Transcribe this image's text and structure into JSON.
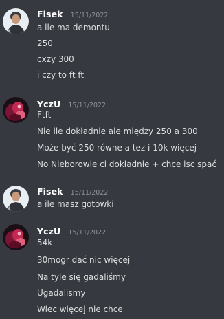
{
  "messages": [
    {
      "username": "Fisek",
      "timestamp": "15/11/2022",
      "lines": [
        "a ile ma demontu",
        "250",
        "cxzy 300",
        "i czy to ft ft"
      ]
    },
    {
      "username": "YczU",
      "timestamp": "15/11/2022",
      "lines": [
        "Ftft",
        "Nie ile dokładnie ale między 250 a 300",
        "Może być 250 równe a tez i 10k więcej",
        "No Nieborowie ci dokładnie + chce isc spać"
      ]
    },
    {
      "username": "Fisek",
      "timestamp": "15/11/2022",
      "lines": [
        "a ile masz gotowki"
      ]
    },
    {
      "username": "YczU",
      "timestamp": "15/11/2022",
      "lines": [
        "54k",
        "30mogr dać nic więcej",
        "Na tyle się gadaliśmy",
        "Ugadalismy",
        "Wiec więcej nie chce"
      ]
    }
  ],
  "colors": {
    "background": "#36393f",
    "username": "#ffffff",
    "timestamp": "#8e9297",
    "text": "#dcddde"
  },
  "avatars": [
    "fisek-avatar-icon",
    "yczu-avatar-icon",
    "fisek-avatar-icon",
    "yczu-avatar-icon"
  ]
}
